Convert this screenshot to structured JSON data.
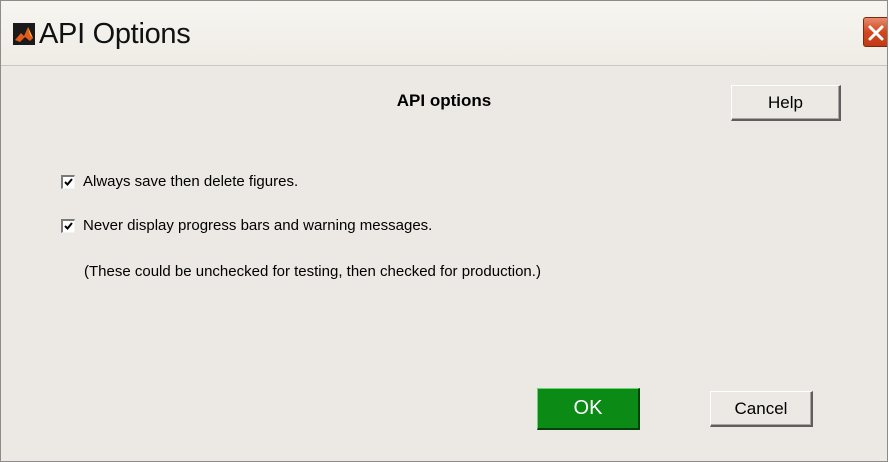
{
  "window": {
    "title": "API Options",
    "colors": {
      "background": "#ece9e4",
      "close": "#d2471f",
      "ok": "#0b8a16"
    }
  },
  "icons": {
    "app": "matlab-logo-icon",
    "close": "close-icon",
    "check": "checkmark-icon"
  },
  "dialog": {
    "heading": "API options",
    "help_label": "Help",
    "options": [
      {
        "label": "Always save then delete figures.",
        "checked": true
      },
      {
        "label": "Never display progress bars and warning messages.",
        "checked": true
      }
    ],
    "note": "(These could be unchecked for testing, then checked for production.)",
    "ok_label": "OK",
    "cancel_label": "Cancel"
  }
}
